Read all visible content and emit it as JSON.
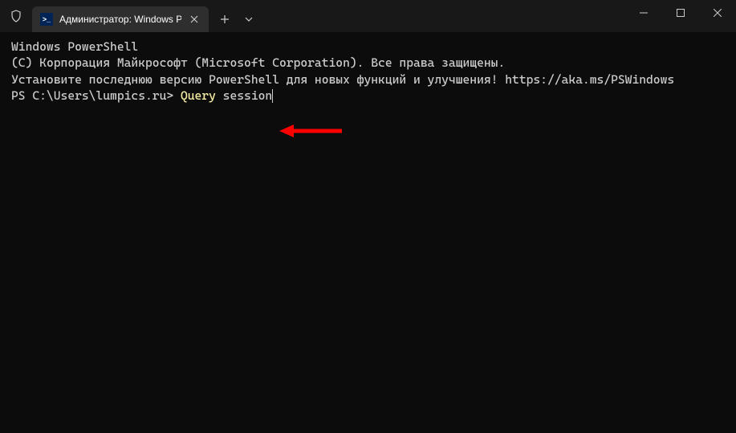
{
  "titlebar": {
    "tab_title": "Администратор: Windows Po",
    "ps_icon_text": ">_"
  },
  "terminal": {
    "line1": "Windows PowerShell",
    "line2": "(C) Корпорация Майкрософт (Microsoft Corporation). Все права защищены.",
    "line3": "",
    "line4": "Установите последнюю версию PowerShell для новых функций и улучшения! https://aka.ms/PSWindows",
    "line5": "",
    "prompt_prefix": "PS C:\\Users\\lumpics.ru> ",
    "prompt_cmd": "Query",
    "prompt_arg": " session"
  }
}
